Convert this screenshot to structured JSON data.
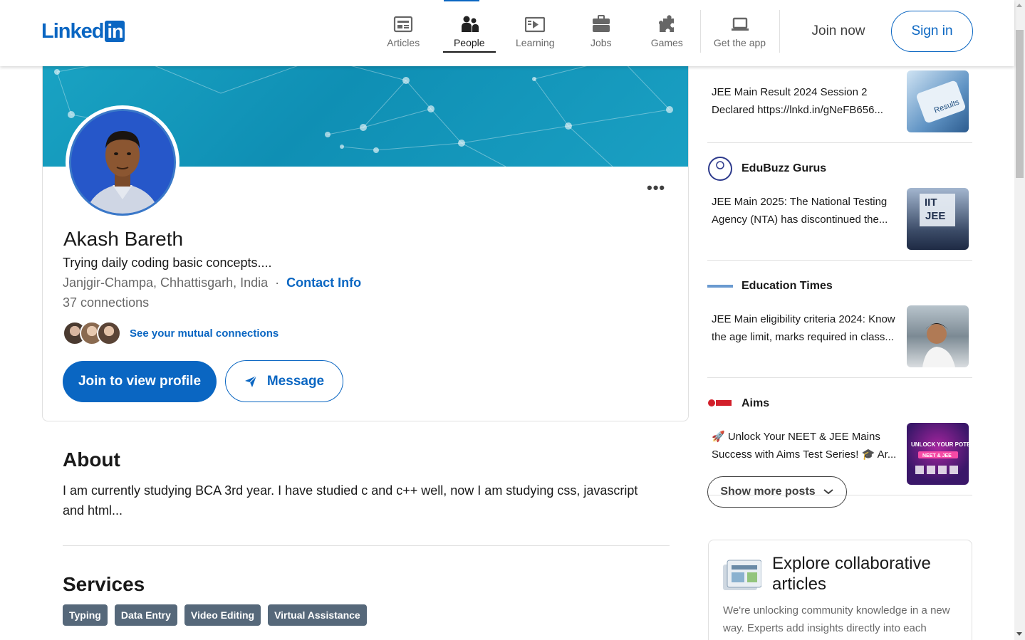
{
  "header": {
    "logo_text": "Linked",
    "logo_in": "in",
    "nav": [
      {
        "label": "Articles",
        "icon": "articles-icon"
      },
      {
        "label": "People",
        "icon": "people-icon",
        "active": true
      },
      {
        "label": "Learning",
        "icon": "learning-icon"
      },
      {
        "label": "Jobs",
        "icon": "jobs-icon"
      },
      {
        "label": "Games",
        "icon": "games-icon"
      }
    ],
    "get_app_label": "Get the app",
    "join_label": "Join now",
    "signin_label": "Sign in"
  },
  "profile": {
    "name": "Akash Bareth",
    "headline": "Trying daily coding basic concepts....",
    "location": "Janjgir-Champa, Chhattisgarh, India",
    "separator": "·",
    "contact_info": "Contact Info",
    "connections": "37 connections",
    "mutual_link": "See your mutual connections",
    "join_view_label": "Join to view profile",
    "message_label": "Message",
    "more_label": "•••"
  },
  "about": {
    "title": "About",
    "text": "I am currently studying BCA 3rd year. I have studied c and c++ well, now I am studying css, javascript and html..."
  },
  "services": {
    "title": "Services",
    "tags": [
      "Typing",
      "Data Entry",
      "Video Editing",
      "Virtual Assistance"
    ]
  },
  "posts": [
    {
      "author": "",
      "text": "JEE Main Result 2024 Session 2 Declared https://lnkd.in/gNeFB656..."
    },
    {
      "author": "EduBuzz Gurus",
      "text": "JEE Main 2025: The National Testing Agency (NTA) has discontinued the..."
    },
    {
      "author": "Education Times",
      "text": "JEE Main eligibility criteria 2024: Know the age limit, marks required in class..."
    },
    {
      "author": "Aims",
      "text": "🚀 Unlock Your NEET & JEE Mains Success with Aims Test Series! 🎓 Ar..."
    }
  ],
  "thumbs": {
    "results": "Results",
    "iit": "IIT",
    "jee": "JEE",
    "unlock": "UNLOCK YOUR POTENTIAL",
    "neet": "NEET & JEE"
  },
  "show_more_label": "Show more posts",
  "explore": {
    "title": "Explore collaborative articles",
    "text": "We're unlocking community knowledge in a new way. Experts add insights directly into each"
  },
  "colors": {
    "brand": "#0a66c2",
    "tag_bg": "#56687a"
  }
}
